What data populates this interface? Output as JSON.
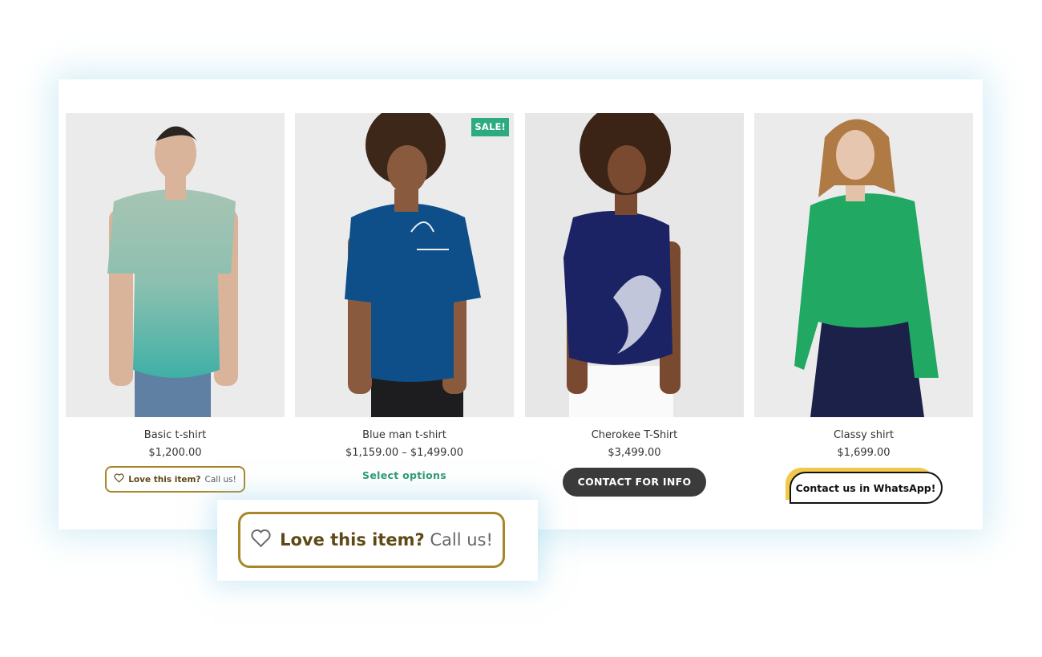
{
  "colors": {
    "sale_badge": "#2bab7f",
    "select_link": "#2b9a6e",
    "love_border": "#a8862a",
    "contact_bg": "#3b3b3b",
    "whatsapp_accent": "#f0c94a"
  },
  "products": [
    {
      "name": "Basic t-shirt",
      "price": "$1,200.00",
      "action": {
        "strong": "Love this item?",
        "rest": "Call us!",
        "icon": "heart-outline-icon"
      }
    },
    {
      "name": "Blue man t-shirt",
      "price": "$1,159.00 – $1,499.00",
      "badge": "SALE!",
      "action": {
        "label": "Select options"
      }
    },
    {
      "name": "Cherokee T-Shirt",
      "price": "$3,499.00",
      "action": {
        "label": "CONTACT FOR INFO"
      }
    },
    {
      "name": "Classy shirt",
      "price": "$1,699.00",
      "action": {
        "label": "Contact us in WhatsApp!"
      }
    }
  ],
  "zoom_preview": {
    "strong": "Love this item?",
    "rest": "Call us!",
    "icon": "heart-outline-icon"
  }
}
